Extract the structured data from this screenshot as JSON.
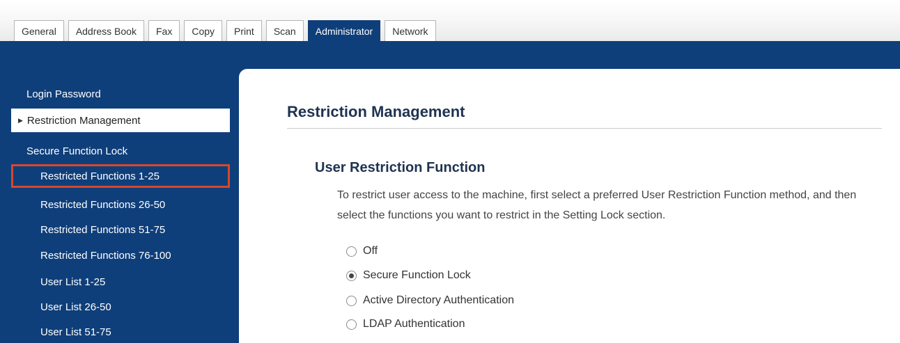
{
  "tabs": [
    {
      "label": "General",
      "active": false
    },
    {
      "label": "Address Book",
      "active": false
    },
    {
      "label": "Fax",
      "active": false
    },
    {
      "label": "Copy",
      "active": false
    },
    {
      "label": "Print",
      "active": false
    },
    {
      "label": "Scan",
      "active": false
    },
    {
      "label": "Administrator",
      "active": true
    },
    {
      "label": "Network",
      "active": false
    }
  ],
  "sidebar": {
    "items": [
      {
        "label": "Login Password",
        "level": 1
      },
      {
        "label": "Restriction Management",
        "level": 1,
        "active": true
      },
      {
        "label": "Secure Function Lock",
        "level": 1
      },
      {
        "label": "Restricted Functions 1-25",
        "level": 2,
        "highlighted": true
      },
      {
        "label": "Restricted Functions 26-50",
        "level": 2
      },
      {
        "label": "Restricted Functions 51-75",
        "level": 2
      },
      {
        "label": "Restricted Functions 76-100",
        "level": 2
      },
      {
        "label": "User List 1-25",
        "level": 2
      },
      {
        "label": "User List 26-50",
        "level": 2
      },
      {
        "label": "User List 51-75",
        "level": 2
      }
    ]
  },
  "main": {
    "title": "Restriction Management",
    "section": {
      "title": "User Restriction Function",
      "description": "To restrict user access to the machine, first select a preferred User Restriction Function method, and then select the functions you want to restrict in the Setting Lock section."
    },
    "options": [
      {
        "label": "Off",
        "checked": false
      },
      {
        "label": "Secure Function Lock",
        "checked": true
      },
      {
        "label": "Active Directory Authentication",
        "checked": false
      },
      {
        "label": "LDAP Authentication",
        "checked": false
      }
    ]
  },
  "colors": {
    "nav_blue": "#0f3f7a",
    "highlight_red": "#d9472b",
    "heading": "#1e3350"
  }
}
